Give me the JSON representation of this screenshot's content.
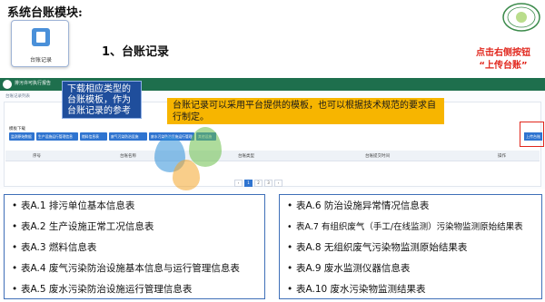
{
  "header": {
    "title": "系统台账模块:"
  },
  "module": {
    "label": "台账记录"
  },
  "section_heading": "1、台账记录",
  "annotation_red": {
    "line1": "点击右侧按钮",
    "line2": "“上传台账”"
  },
  "app": {
    "title": "排污许可执行报告",
    "breadcrumb": "台账记录列表",
    "template_label": "模板下载",
    "template_buttons": [
      "监测原始数据",
      "生产设施运行管理信息",
      "燃料信息表",
      "废气污染防治设施",
      "废水污染防治设施运行管理",
      "其他设施"
    ],
    "upload_button": "上传台账",
    "table_headers": [
      "序号",
      "台账名称",
      "台账类型",
      "台账提交时间",
      "操作"
    ],
    "pager": {
      "prev": "‹",
      "pages": [
        "1",
        "2",
        "3"
      ],
      "next": "›",
      "active": "1"
    }
  },
  "callout_blue": "下载相应类型的台账模板，作为台账记录的参考",
  "callout_yellow": "台账记录可以采用平台提供的模板，也可以根据技术规范的要求自行制定。",
  "left_list": [
    "表A.1 排污单位基本信息表",
    "表A.2 生产设施正常工况信息表",
    "表A.3 燃料信息表",
    "表A.4 废气污染防治设施基本信息与运行管理信息表",
    "表A.5 废水污染防治设施运行管理信息表"
  ],
  "right_list": [
    "表A.6 防治设施异常情况信息表",
    "表A.7 有组织废气（手工/在线监测）污染物监测原始结果表",
    "表A.8 无组织废气污染物监测原始结果表",
    "表A.9 废水监测仪器信息表",
    "表A.10 废水污染物监测结果表"
  ],
  "colors": {
    "accent_blue": "#2f74d0",
    "callout_blue": "#1f4e9c",
    "callout_yellow": "#f7b500",
    "alert_red": "#e1261c",
    "app_green": "#1e6f4d"
  }
}
